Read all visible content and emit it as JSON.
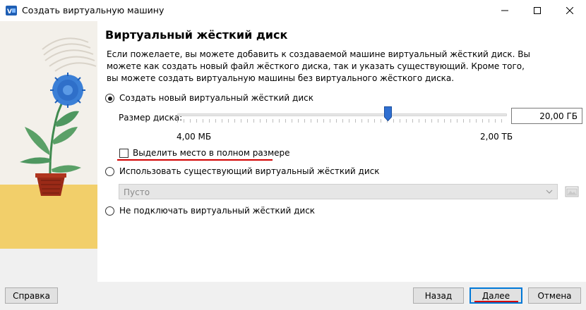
{
  "window": {
    "title": "Создать виртуальную машину"
  },
  "page": {
    "title": "Виртуальный жёсткий диск",
    "description": "Если пожелаете, вы можете добавить к создаваемой машине виртуальный жёсткий диск. Вы можете как создать новый файл жёсткого диска, так и указать существующий. Кроме того, вы можете создать виртуальную машины без виртуального жёсткого диска."
  },
  "options": {
    "create_new": {
      "label": "Создать новый виртуальный жёсткий диск",
      "selected": true
    },
    "disk_size": {
      "label": "Размер диска:",
      "value": "20,00 ГБ",
      "min_label": "4,00 МБ",
      "max_label": "2,00 ТБ",
      "slider_fraction": 0.64
    },
    "preallocate": {
      "label": "Выделить место в полном размере",
      "checked": false
    },
    "use_existing": {
      "label": "Использовать существующий виртуальный жёсткий диск",
      "selected": false
    },
    "existing_combo": {
      "value": "Пусто"
    },
    "no_disk": {
      "label": "Не подключать виртуальный жёсткий диск",
      "selected": false
    }
  },
  "footer": {
    "help": "Справка",
    "back": "Назад",
    "next": "Далее",
    "cancel": "Отмена"
  },
  "colors": {
    "accent": "#0078d7",
    "highlight_underline": "#d30000",
    "thumb": "#2f6fd1"
  },
  "icons": [
    "virtualbox-icon",
    "minimize-icon",
    "maximize-icon",
    "close-icon",
    "slider-thumb",
    "chevron-down-icon",
    "folder-icon"
  ]
}
